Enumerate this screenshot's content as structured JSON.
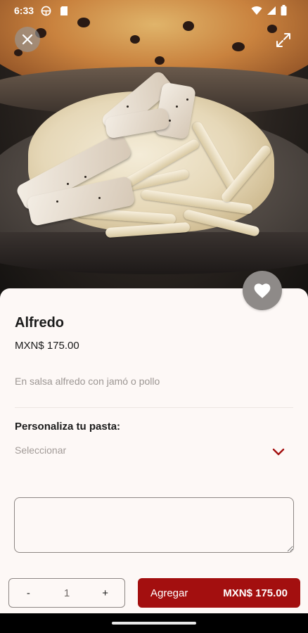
{
  "status_bar": {
    "time": "6:33"
  },
  "product": {
    "name": "Alfredo",
    "price": "MXN$ 175.00",
    "description": "En salsa alfredo con jamó o pollo"
  },
  "customization": {
    "label": "Personaliza tu pasta:",
    "placeholder": "Seleccionar"
  },
  "notes": {
    "value": ""
  },
  "cart": {
    "decrement": "-",
    "quantity": "1",
    "increment": "+",
    "add_label": "Agregar",
    "add_total": "MXN$ 175.00"
  },
  "colors": {
    "accent": "#a30f0f",
    "background": "#fdf8f6",
    "text": "#1b1b1b",
    "muted": "#9c9693"
  },
  "icons": {
    "close": "close-icon",
    "expand": "expand-icon",
    "favorite": "heart-icon",
    "dropdown": "chevron-down-icon"
  }
}
